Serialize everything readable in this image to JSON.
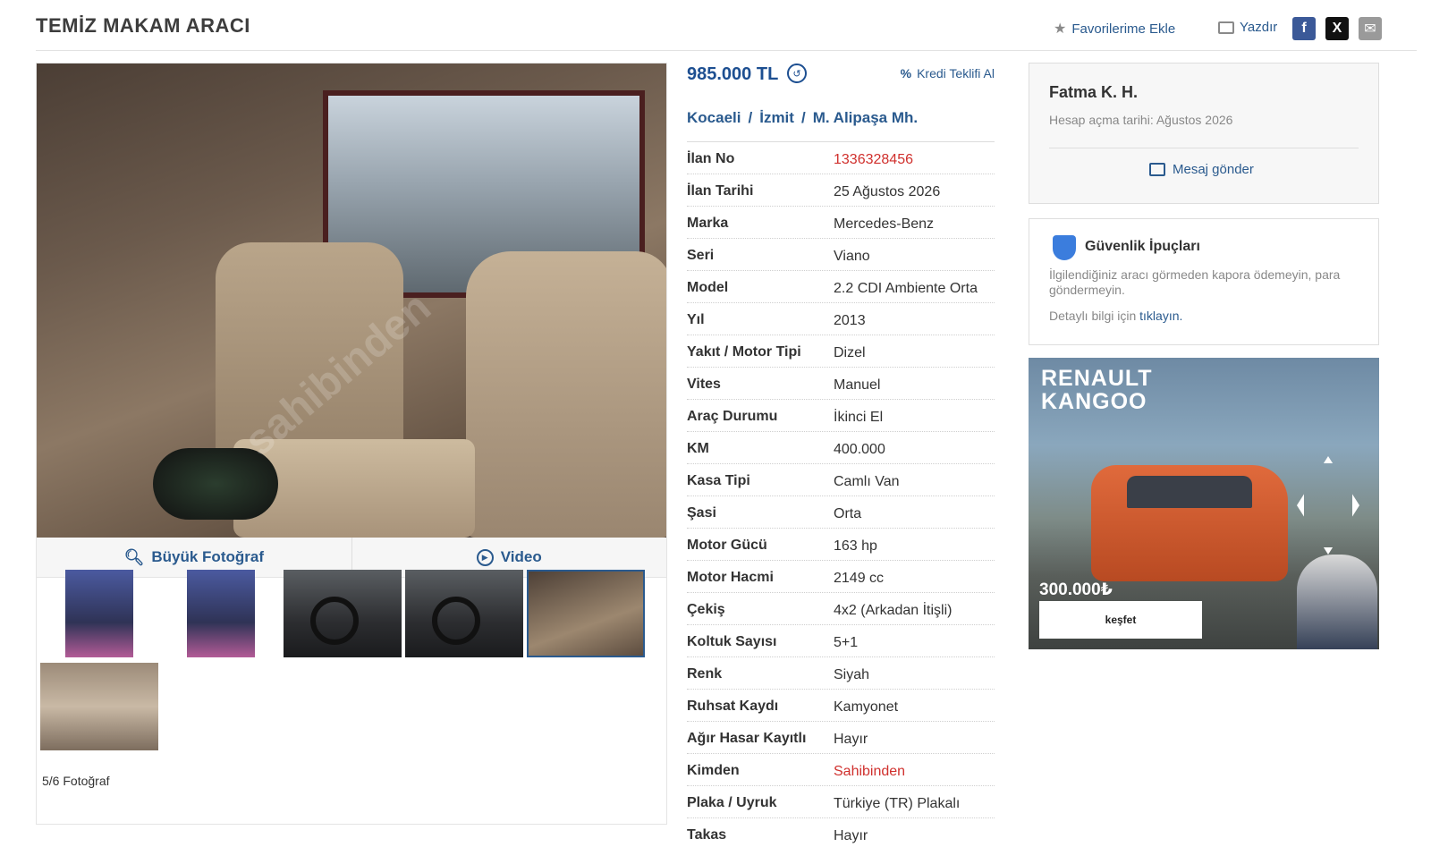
{
  "header": {
    "title": "TEMİZ MAKAM ARACI",
    "favorite_label": "Favorilerime Ekle",
    "print_label": "Yazdır"
  },
  "gallery": {
    "big_photo_label": "Büyük Fotoğraf",
    "video_label": "Video",
    "photo_count": "5/6 Fotoğraf",
    "watermark": "sahibinden"
  },
  "listing": {
    "price": "985.000 TL",
    "credit_label": "Kredi Teklifi Al",
    "location": [
      "Kocaeli",
      "İzmit",
      "M. Alipaşa Mh."
    ],
    "specs": [
      {
        "label": "İlan No",
        "value": "1336328456",
        "highlight": true
      },
      {
        "label": "İlan Tarihi",
        "value": "25 Ağustos 2026"
      },
      {
        "label": "Marka",
        "value": "Mercedes-Benz"
      },
      {
        "label": "Seri",
        "value": "Viano"
      },
      {
        "label": "Model",
        "value": "2.2 CDI Ambiente Orta"
      },
      {
        "label": "Yıl",
        "value": "2013"
      },
      {
        "label": "Yakıt / Motor Tipi",
        "value": "Dizel"
      },
      {
        "label": "Vites",
        "value": "Manuel"
      },
      {
        "label": "Araç Durumu",
        "value": "İkinci El"
      },
      {
        "label": "KM",
        "value": "400.000"
      },
      {
        "label": "Kasa Tipi",
        "value": "Camlı Van"
      },
      {
        "label": "Şasi",
        "value": "Orta"
      },
      {
        "label": "Motor Gücü",
        "value": "163 hp"
      },
      {
        "label": "Motor Hacmi",
        "value": "2149 cc"
      },
      {
        "label": "Çekiş",
        "value": "4x2 (Arkadan İtişli)"
      },
      {
        "label": "Koltuk Sayısı",
        "value": "5+1"
      },
      {
        "label": "Renk",
        "value": "Siyah"
      },
      {
        "label": "Ruhsat Kaydı",
        "value": "Kamyonet"
      },
      {
        "label": "Ağır Hasar Kayıtlı",
        "value": "Hayır"
      },
      {
        "label": "Kimden",
        "value": "Sahibinden",
        "highlight": true
      },
      {
        "label": "Plaka / Uyruk",
        "value": "Türkiye (TR) Plakalı"
      },
      {
        "label": "Takas",
        "value": "Hayır"
      }
    ]
  },
  "seller": {
    "name": "Fatma K. H.",
    "since": "Hesap açma tarihi: Ağustos 2026",
    "message_label": "Mesaj gönder"
  },
  "safety": {
    "title": "Güvenlik İpuçları",
    "text": "İlgilendiğiniz aracı görmeden kapora ödemeyin, para göndermeyin.",
    "more_prefix": "Detaylı bilgi için",
    "more_link": "tıklayın."
  },
  "ad": {
    "title": "RENAULT\nKANGOO",
    "price": "300.000₺",
    "cta": "keşfet"
  },
  "colors": {
    "link": "#2a5a8e",
    "price": "#1d4f91",
    "highlight": "#d0302d"
  },
  "icons": [
    "star-icon",
    "printer-icon",
    "facebook-icon",
    "x-icon",
    "mail-icon",
    "history-icon",
    "percent-icon",
    "search-icon",
    "play-icon",
    "chat-icon",
    "shield-icon"
  ]
}
